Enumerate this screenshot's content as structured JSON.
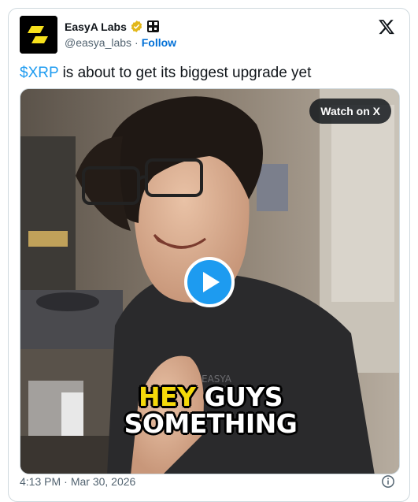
{
  "author": {
    "name": "EasyA Labs",
    "handle": "@easya_labs",
    "separator": "·",
    "follow_label": "Follow"
  },
  "tweet": {
    "cashtag": "$XRP",
    "text": " is about to get its biggest upgrade yet"
  },
  "media": {
    "watch_label": "Watch on X",
    "caption_line1_highlight": "HEY",
    "caption_line1_rest": " GUYS",
    "caption_line2": "SOMETHING",
    "shirt_print": "EASYA"
  },
  "footer": {
    "time": "4:13 PM",
    "separator": "·",
    "date": "Mar 30, 2026"
  },
  "colors": {
    "accent": "#1d9bf0",
    "follow": "#006fd6",
    "verified": "#e2b719",
    "avatar_mark": "#f7e11c",
    "caption_highlight": "#f5d90a"
  }
}
